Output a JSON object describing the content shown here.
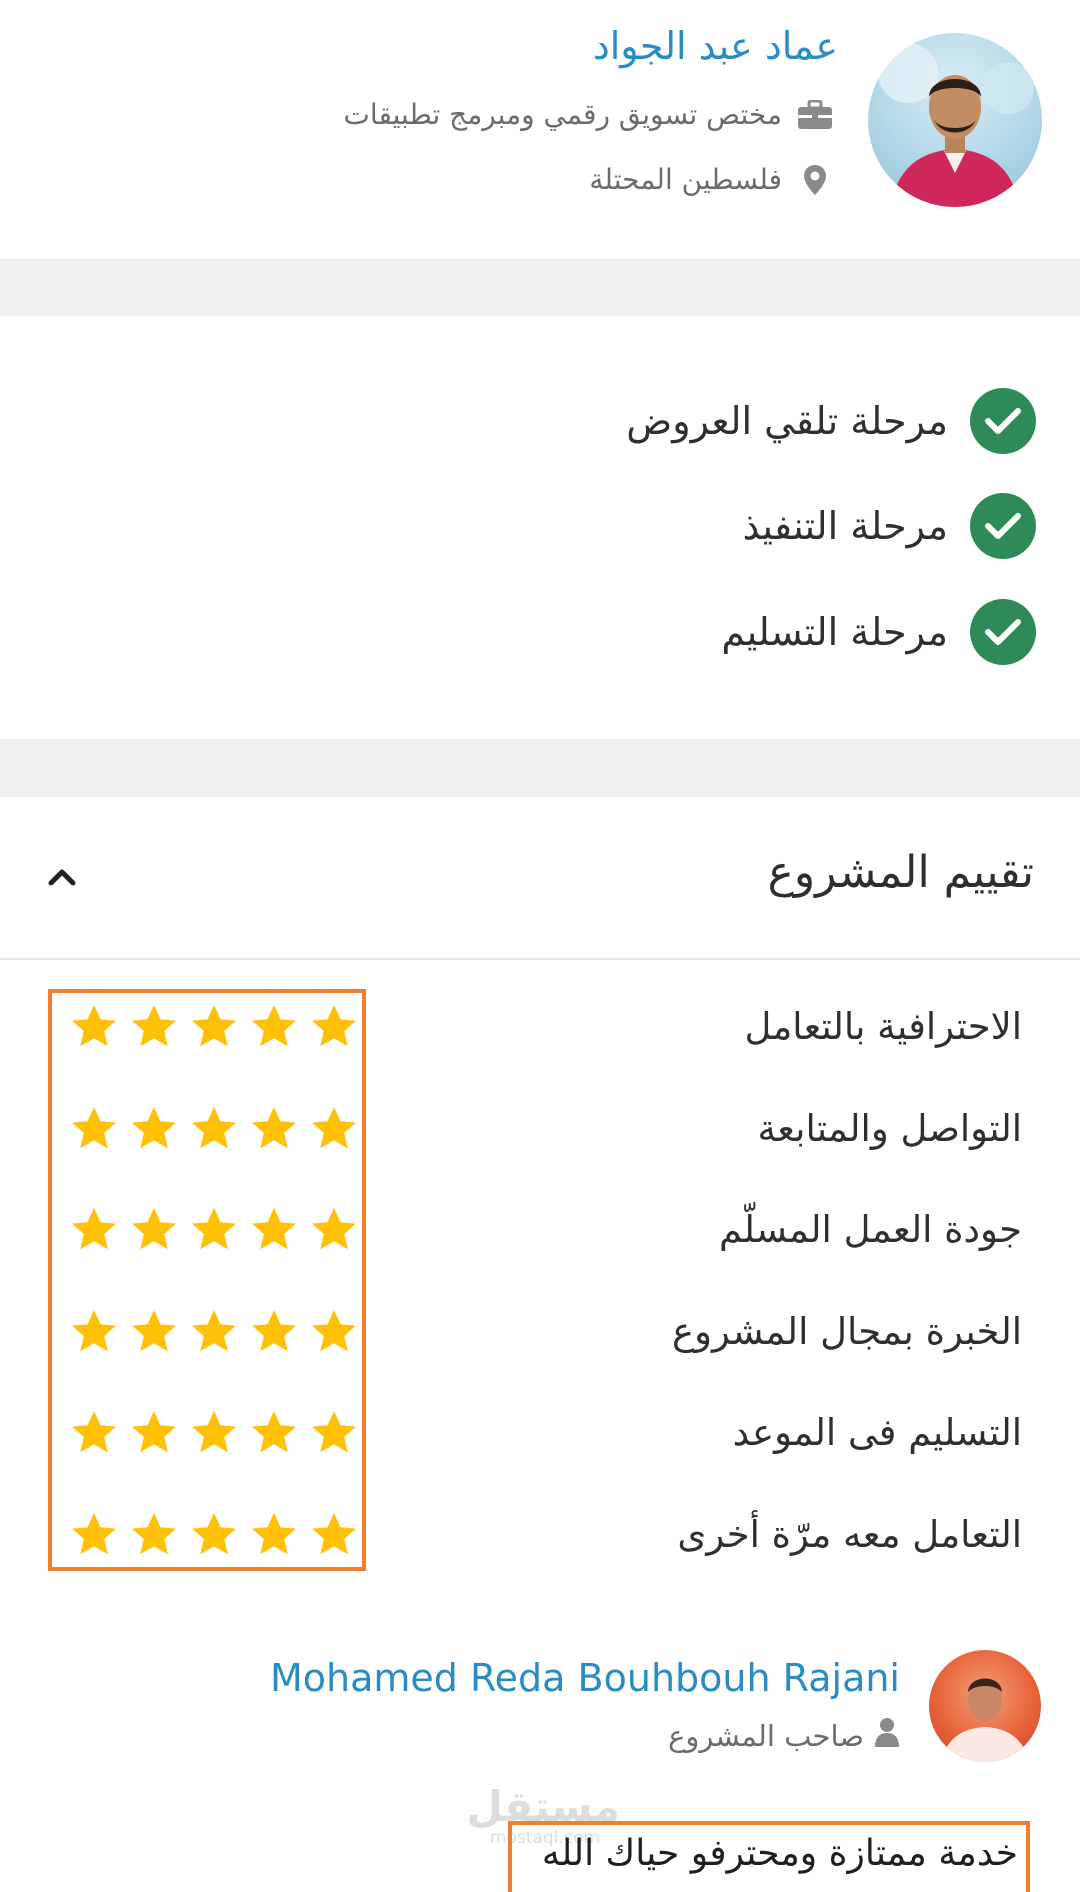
{
  "freelancer": {
    "name": "عماد عبد الجواد",
    "job_title": "مختص تسويق رقمي ومبرمج تطبيقات",
    "location": "فلسطين المحتلة",
    "icons": {
      "job": "briefcase-icon",
      "location": "map-pin-icon"
    }
  },
  "stages": [
    {
      "label": "مرحلة تلقي العروض",
      "status": "done"
    },
    {
      "label": "مرحلة التنفيذ",
      "status": "done"
    },
    {
      "label": "مرحلة التسليم",
      "status": "done"
    }
  ],
  "rating": {
    "title": "تقييم المشروع",
    "toggle_icon": "chevron-up-icon",
    "criteria": [
      {
        "label": "الاحترافية بالتعامل",
        "stars": 5
      },
      {
        "label": "التواصل والمتابعة",
        "stars": 5
      },
      {
        "label": "جودة العمل المسلّم",
        "stars": 5
      },
      {
        "label": "الخبرة بمجال المشروع",
        "stars": 5
      },
      {
        "label": "التسليم فى الموعد",
        "stars": 5
      },
      {
        "label": "التعامل معه مرّة أخرى",
        "stars": 5
      }
    ],
    "max_stars": 5
  },
  "review": {
    "reviewer_name": "Mohamed Reda Bouhbouh Rajani",
    "reviewer_role": "صاحب المشروع",
    "comment": "خدمة ممتازة ومحترفو حياك الله"
  },
  "watermark": {
    "arabic": "مستقل",
    "latin": "mostaql.com"
  },
  "colors": {
    "link_blue": "#2b8cc4",
    "check_green": "#2e8b57",
    "star_gold": "#ffc107",
    "highlight_orange": "#f07f2e",
    "band_gray": "#efefef"
  }
}
